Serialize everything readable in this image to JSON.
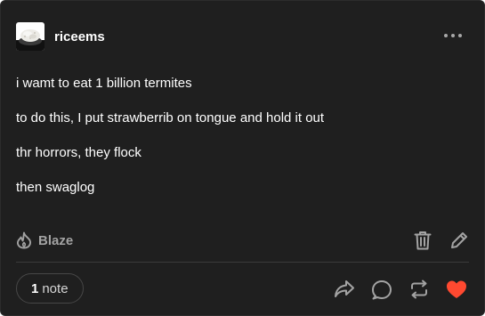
{
  "post": {
    "author": {
      "username": "riceems",
      "avatar_icon": "rice-bowl-avatar"
    },
    "menu_icon": "more-options-icon",
    "body": [
      "i wamt to eat 1 billion termites",
      "to do this, I put strawberrib on tongue and hold it out",
      "thr horrors, they flock",
      "then swaglog"
    ],
    "blaze": {
      "label": "Blaze",
      "icon": "flame-icon"
    },
    "owner_actions": [
      {
        "name": "delete",
        "icon": "trash-icon"
      },
      {
        "name": "edit",
        "icon": "pencil-icon"
      }
    ],
    "notes": {
      "count": "1",
      "label": "note"
    },
    "engagement": [
      {
        "name": "share",
        "icon": "share-arrow-icon"
      },
      {
        "name": "reply",
        "icon": "speech-bubble-icon"
      },
      {
        "name": "reblog",
        "icon": "reblog-icon"
      },
      {
        "name": "like",
        "icon": "heart-icon",
        "liked": true
      }
    ],
    "colors": {
      "card_background": "#1f1f1f",
      "text": "#ffffff",
      "muted": "#a3a3a3",
      "like_active": "#ff4930"
    }
  }
}
